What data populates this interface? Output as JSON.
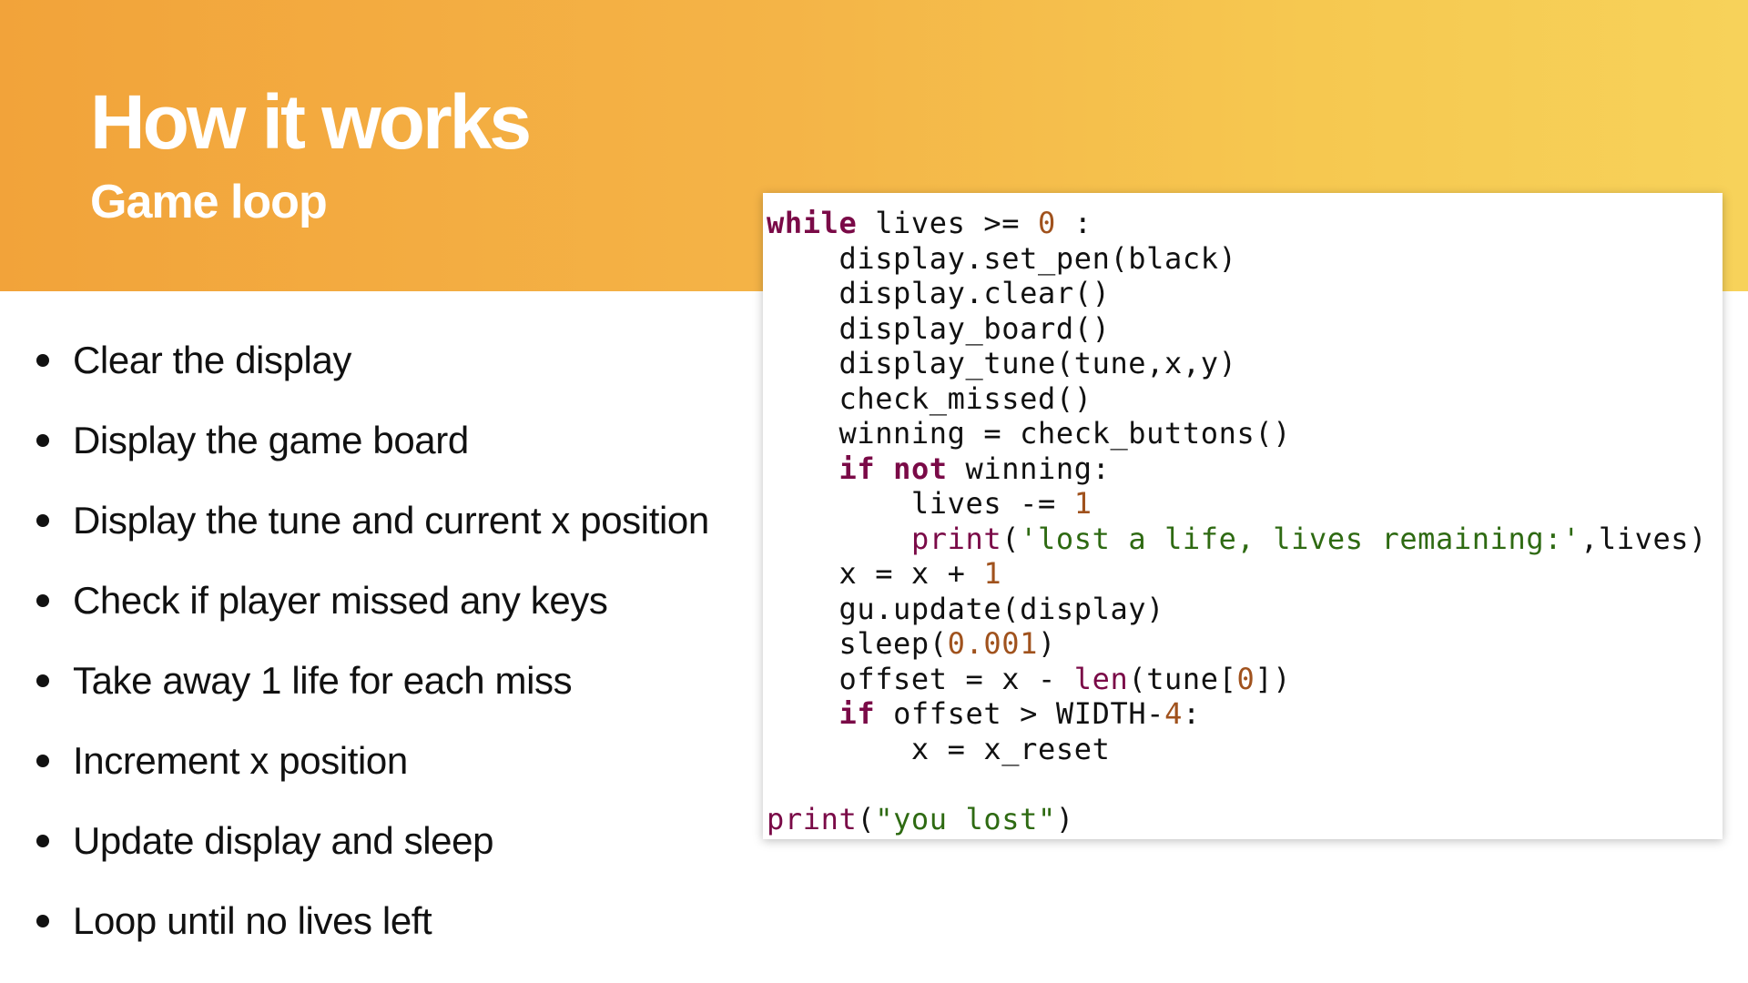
{
  "slide": {
    "title": "How it works",
    "subtitle": "Game loop",
    "colors": {
      "header_gradient_start": "#F2A33A",
      "header_gradient_end": "#F7D25A",
      "title_text": "#FFFFFF",
      "body_text": "#111111",
      "code_keyword": "#7A0A47",
      "code_number": "#A0521D",
      "code_string": "#2E6A12"
    }
  },
  "bullets": [
    "Clear the display",
    "Display the game board",
    "Display the tune and current x position",
    "Check if player missed any keys",
    "Take away 1 life for each miss",
    "Increment x position",
    "Update display and sleep",
    "Loop until no lives left"
  ],
  "code": {
    "language": "python",
    "lines": [
      [
        {
          "t": "while",
          "k": "kw"
        },
        {
          "t": " lives >= "
        },
        {
          "t": "0",
          "k": "num"
        },
        {
          "t": " :"
        }
      ],
      [
        {
          "t": "    display.set_pen(black)"
        }
      ],
      [
        {
          "t": "    display.clear()"
        }
      ],
      [
        {
          "t": "    display_board()"
        }
      ],
      [
        {
          "t": "    display_tune(tune,x,y)"
        }
      ],
      [
        {
          "t": "    check_missed()"
        }
      ],
      [
        {
          "t": "    winning = check_buttons()"
        }
      ],
      [
        {
          "t": "    "
        },
        {
          "t": "if",
          "k": "kw"
        },
        {
          "t": " "
        },
        {
          "t": "not",
          "k": "kw"
        },
        {
          "t": " winning:"
        }
      ],
      [
        {
          "t": "        lives -= "
        },
        {
          "t": "1",
          "k": "num"
        }
      ],
      [
        {
          "t": "        "
        },
        {
          "t": "print",
          "k": "bi"
        },
        {
          "t": "("
        },
        {
          "t": "'lost a life, lives remaining:'",
          "k": "str"
        },
        {
          "t": ",lives)"
        }
      ],
      [
        {
          "t": "    x = x + "
        },
        {
          "t": "1",
          "k": "num"
        }
      ],
      [
        {
          "t": "    gu.update(display)"
        }
      ],
      [
        {
          "t": "    sleep("
        },
        {
          "t": "0.001",
          "k": "num"
        },
        {
          "t": ")"
        }
      ],
      [
        {
          "t": "    offset = x - "
        },
        {
          "t": "len",
          "k": "bi"
        },
        {
          "t": "(tune["
        },
        {
          "t": "0",
          "k": "num"
        },
        {
          "t": "])"
        }
      ],
      [
        {
          "t": "    "
        },
        {
          "t": "if",
          "k": "kw"
        },
        {
          "t": " offset > WIDTH-"
        },
        {
          "t": "4",
          "k": "num"
        },
        {
          "t": ":"
        }
      ],
      [
        {
          "t": "        x = x_reset"
        }
      ],
      [],
      [
        {
          "t": "print",
          "k": "bi"
        },
        {
          "t": "("
        },
        {
          "t": "\"you lost\"",
          "k": "str"
        },
        {
          "t": ")"
        }
      ]
    ]
  }
}
